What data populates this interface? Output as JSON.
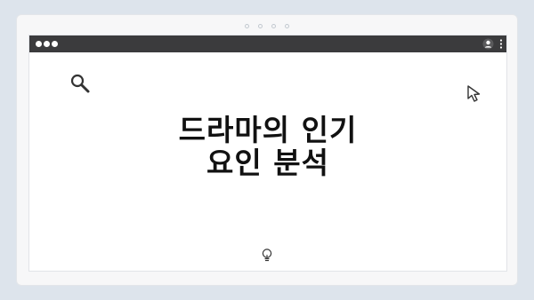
{
  "page": {
    "title_line1": "드라마의 인기",
    "title_line2": "요인 분석"
  },
  "icons": {
    "search": "search-icon",
    "cursor": "cursor-arrow-icon",
    "user": "user-icon",
    "menu": "kebab-menu-icon",
    "idea": "lightbulb-icon"
  },
  "colors": {
    "background": "#dde4ec",
    "device": "#f7f7f8",
    "titlebar": "#3b3b3d",
    "text": "#111111"
  }
}
